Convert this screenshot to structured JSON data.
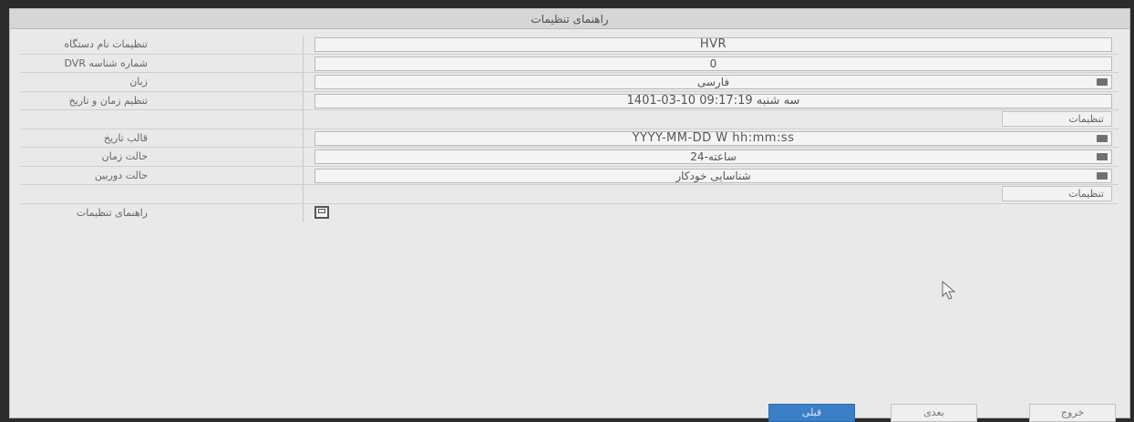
{
  "window": {
    "title": "راهنمای تنظیمات"
  },
  "rows": [
    {
      "label": "تنظیمات نام دستگاه",
      "value": "HVR"
    },
    {
      "label": "DVR شماره شناسه",
      "value": "0"
    },
    {
      "label": "زبان",
      "value": "فارسی"
    },
    {
      "label": "تنظیم زمان و تاریخ",
      "value": "1401-03-10 سه شنبه 09:17:19"
    },
    {
      "label": "قالب تاریخ",
      "value": "YYYY-MM-DD W hh:mm:ss"
    },
    {
      "label": "حالت زمان",
      "value": "24-ساعته"
    },
    {
      "label": "حالت دوربین",
      "value": "شناسایی خودکار"
    },
    {
      "label": "راهنمای تنظیمات",
      "checked": true
    }
  ],
  "buttons": {
    "settings_label": "تنظیمات",
    "prev_label": "قبلی",
    "next_label": "بعدی",
    "exit_label": "خروج"
  },
  "colors": {
    "primary_button": "#3b7fc6",
    "frame_background": "#e9e9e9"
  },
  "icons": [
    "dropdown-arrow-icon",
    "checkbox-checked-icon",
    "mouse-cursor-icon"
  ]
}
